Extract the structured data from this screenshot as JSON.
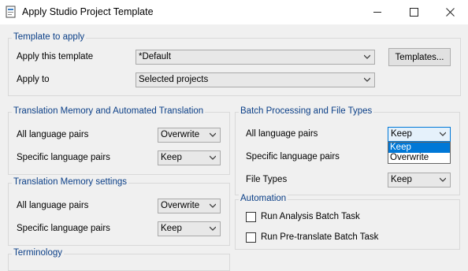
{
  "window": {
    "title": "Apply Studio Project Template"
  },
  "template_group": {
    "legend": "Template to apply",
    "apply_template_label": "Apply this template",
    "apply_template_value": "*Default",
    "templates_button": "Templates...",
    "apply_to_label": "Apply to",
    "apply_to_value": "Selected projects"
  },
  "tm_auto_group": {
    "legend": "Translation Memory and Automated Translation",
    "all_pairs_label": "All language pairs",
    "all_pairs_value": "Overwrite",
    "specific_pairs_label": "Specific language pairs",
    "specific_pairs_value": "Keep"
  },
  "tm_settings_group": {
    "legend": "Translation Memory settings",
    "all_pairs_label": "All language pairs",
    "all_pairs_value": "Overwrite",
    "specific_pairs_label": "Specific language pairs",
    "specific_pairs_value": "Keep"
  },
  "terminology_group": {
    "legend": "Terminology"
  },
  "batch_group": {
    "legend": "Batch Processing and File Types",
    "all_pairs_label": "All language pairs",
    "all_pairs_value": "Keep",
    "dropdown_options": [
      "Keep",
      "Overwrite"
    ],
    "specific_pairs_label": "Specific language pairs",
    "file_types_label": "File Types",
    "file_types_value": "Keep"
  },
  "automation_group": {
    "legend": "Automation",
    "run_analysis_label": "Run Analysis Batch Task",
    "run_pretranslate_label": "Run Pre-translate Batch Task"
  },
  "icons": {
    "app": "document-template-icon",
    "dropdown": "chevron-down-icon"
  },
  "colors": {
    "legend_text": "#0b3f87",
    "selection": "#0078d7"
  }
}
